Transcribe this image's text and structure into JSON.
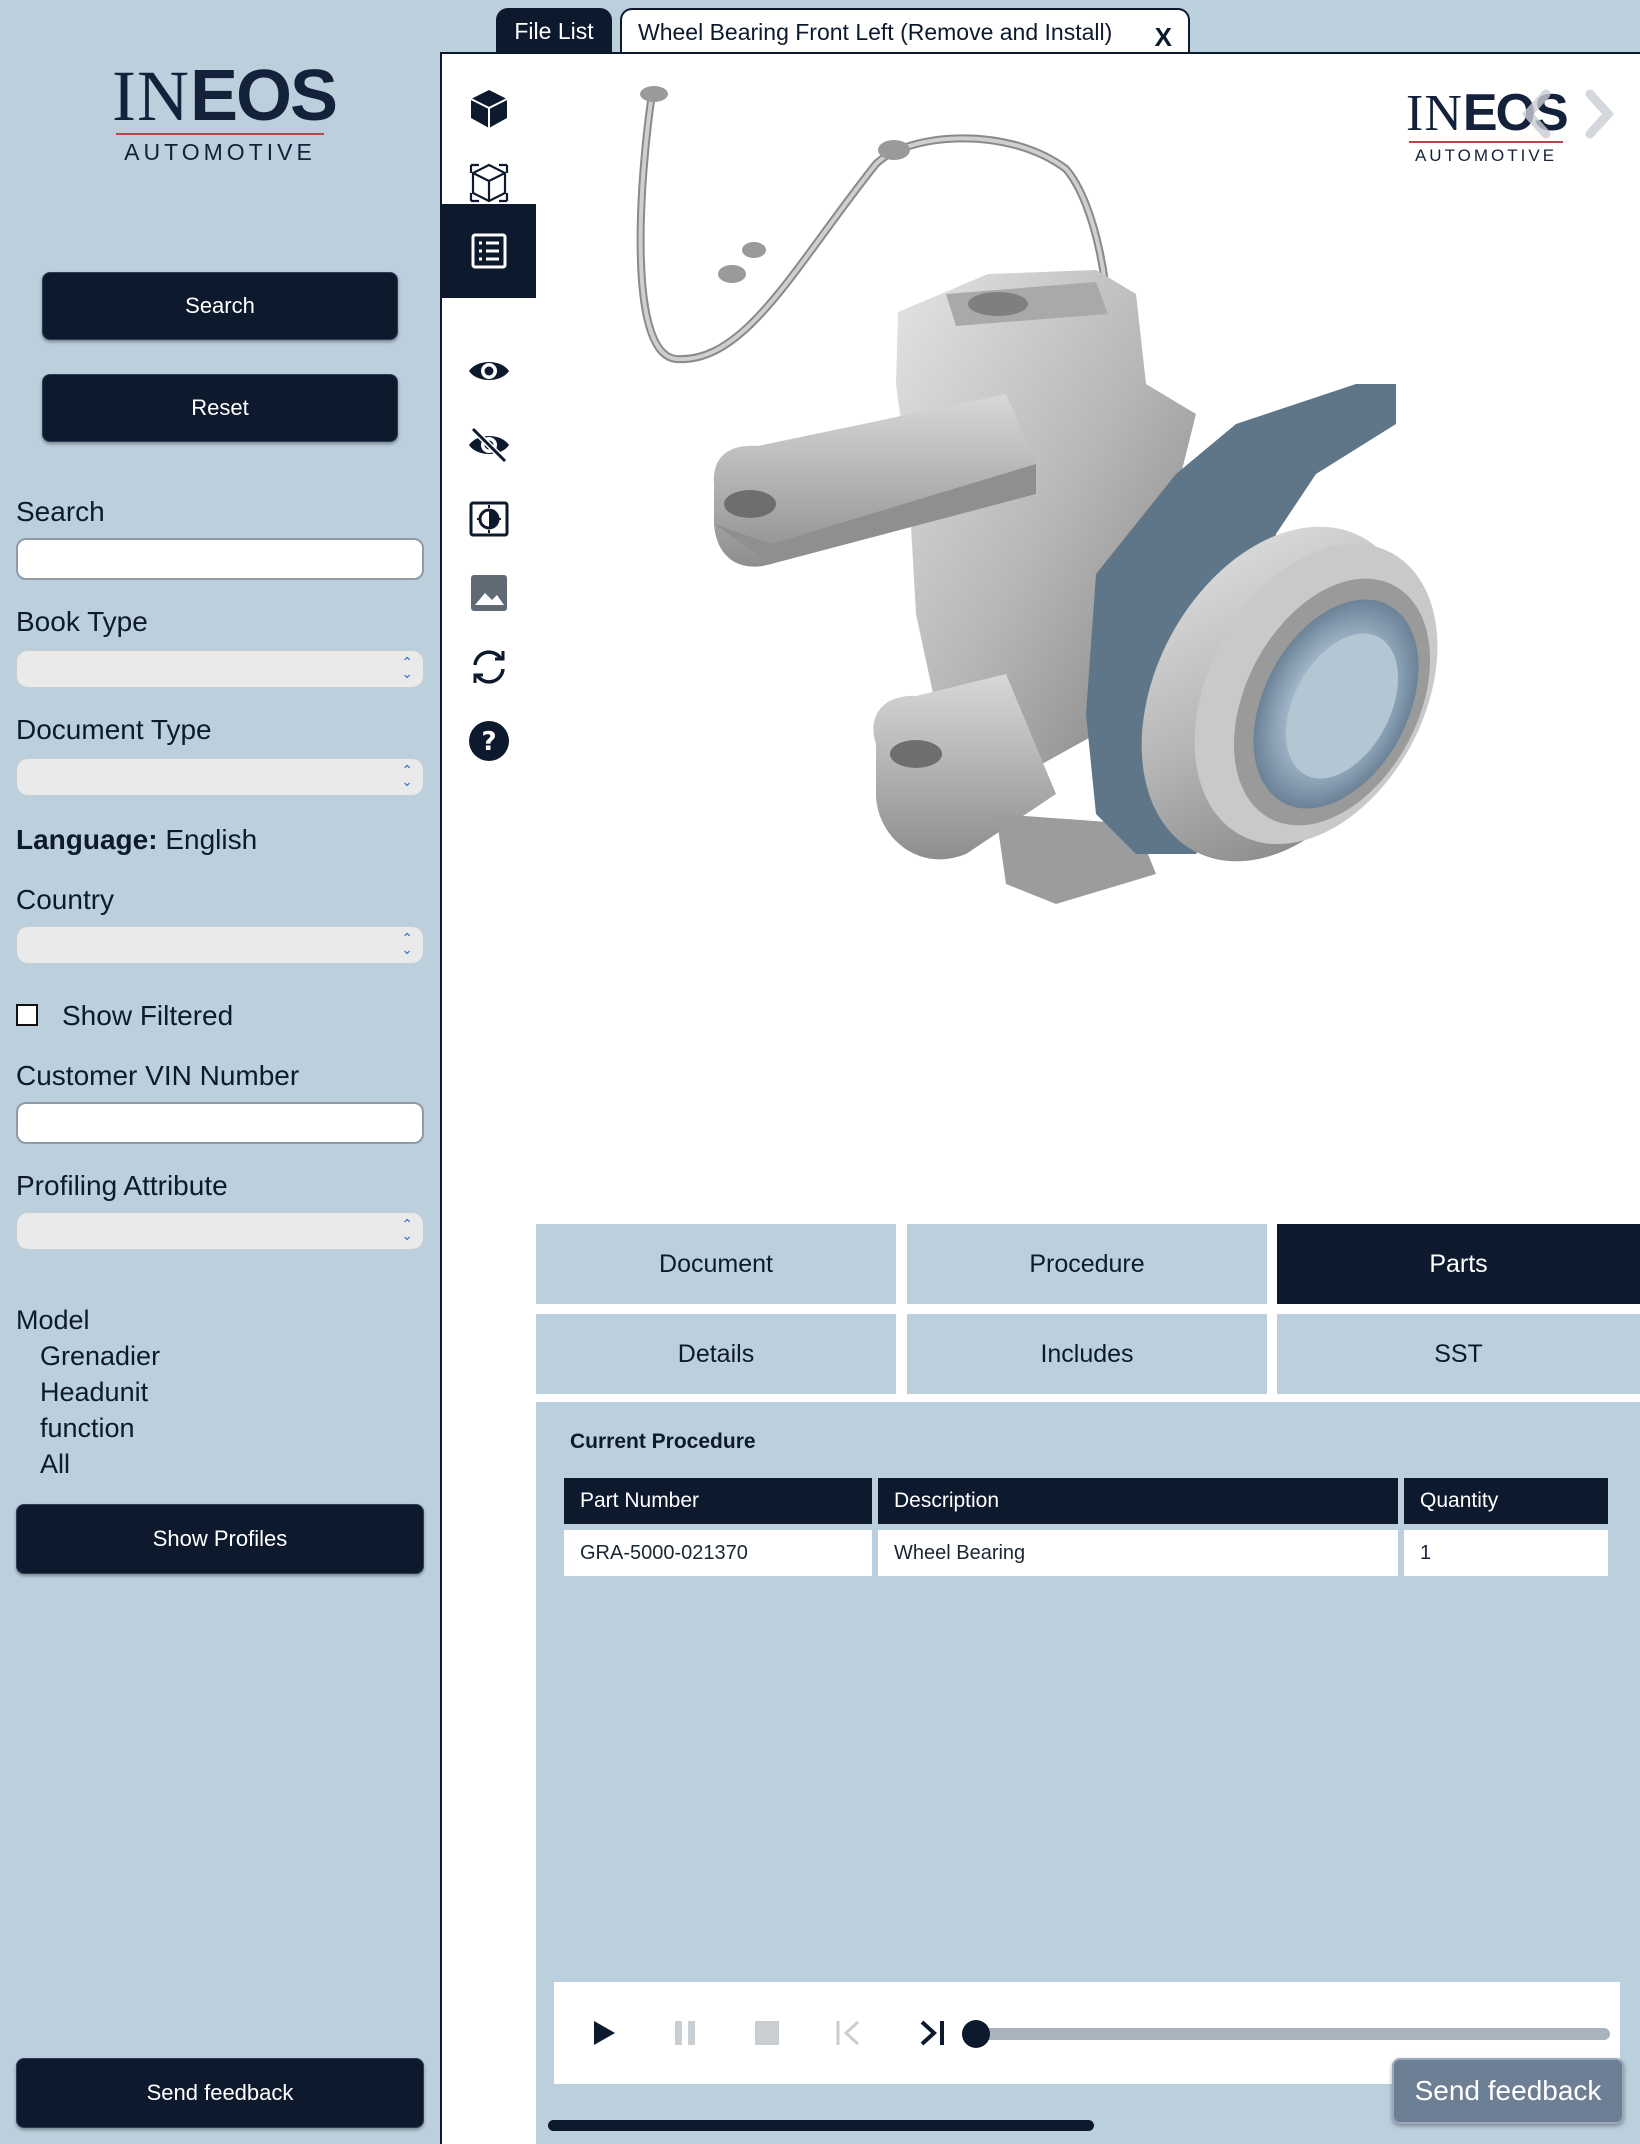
{
  "brand": {
    "logo_main_a": "IN",
    "logo_main_b": "EOS",
    "logo_sub": "AUTOMOTIVE"
  },
  "sidebar": {
    "search_button": "Search",
    "reset_button": "Reset",
    "search_label": "Search",
    "search_value": "",
    "book_type_label": "Book Type",
    "document_type_label": "Document Type",
    "language_label": "Language:",
    "language_value": "English",
    "country_label": "Country",
    "show_filtered_label": "Show Filtered",
    "show_filtered_checked": false,
    "vin_label": "Customer VIN Number",
    "vin_value": "",
    "profiling_label": "Profiling Attribute",
    "model_heading": "Model",
    "model_items": [
      "Grenadier",
      "Headunit",
      "function",
      "All"
    ],
    "show_profiles_button": "Show  Profiles",
    "send_feedback_button": "Send feedback"
  },
  "tabs": {
    "file_list": "File List",
    "document_title": "Wheel Bearing Front Left (Remove and Install)",
    "close": "X"
  },
  "toolbar": {
    "tools": [
      "cube-icon",
      "wireframe-cube-icon",
      "list-icon",
      "eye-icon",
      "eye-off-icon",
      "contrast-icon",
      "image-icon",
      "sync-icon",
      "help-icon"
    ],
    "active": "list-icon"
  },
  "panel_tabs": {
    "row1": [
      "Document",
      "Procedure",
      "Parts"
    ],
    "row2": [
      "Details",
      "Includes",
      "SST"
    ],
    "active": "Parts"
  },
  "parts_panel": {
    "title": "Current Procedure",
    "columns": [
      "Part Number",
      "Description",
      "Quantity"
    ],
    "rows": [
      [
        "GRA-5000-021370",
        "Wheel Bearing",
        "1"
      ]
    ]
  },
  "player": {
    "progress": 0
  },
  "floating_feedback": "Send feedback",
  "colors": {
    "navy": "#0d1a2e",
    "panel_bg": "#bccfdc",
    "accent_red": "#b9464a"
  }
}
